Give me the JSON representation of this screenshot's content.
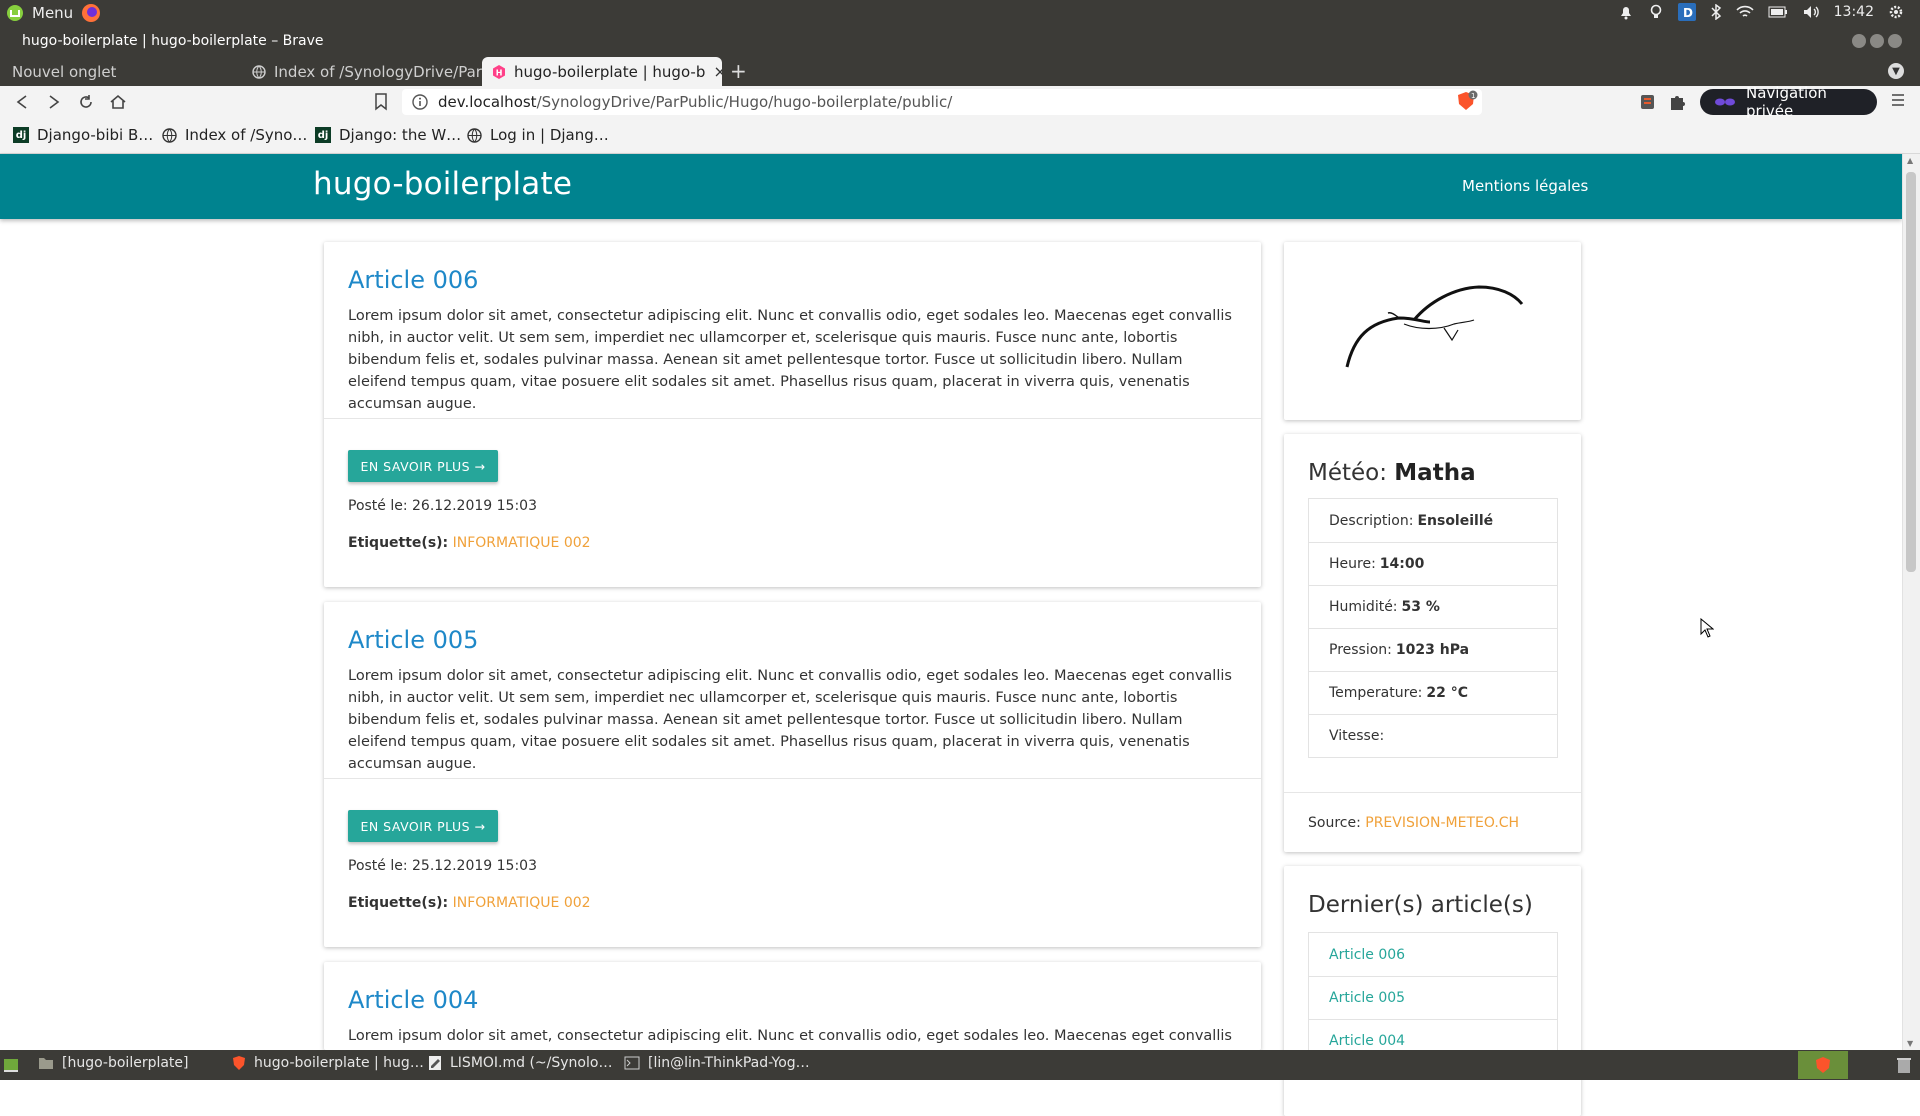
{
  "os": {
    "menu_label": "Menu",
    "clock": "13:42"
  },
  "window": {
    "title": "hugo-boilerplate | hugo-boilerplate – Brave"
  },
  "tabs": [
    {
      "label": "Nouvel onglet"
    },
    {
      "label": "Index of /SynologyDrive/ParP"
    },
    {
      "label": "hugo-boilerplate | hugo-b"
    }
  ],
  "toolbar": {
    "url_host": "dev.localhost",
    "url_path": "/SynologyDrive/ParPublic/Hugo/hugo-boilerplate/public/",
    "shield_count": "1",
    "private_label": "Navigation privée"
  },
  "bookmarks": [
    {
      "label": "Django-bibi B…",
      "icon": "django-icon"
    },
    {
      "label": "Index of /Syno…",
      "icon": "globe-icon"
    },
    {
      "label": "Django: the W…",
      "icon": "django-icon"
    },
    {
      "label": "Log in | Djang…",
      "icon": "globe-icon"
    }
  ],
  "site": {
    "title": "hugo-boilerplate",
    "nav_legal": "Mentions légales"
  },
  "articles": [
    {
      "title": "Article 006",
      "body": "Lorem ipsum dolor sit amet, consectetur adipiscing elit. Nunc et convallis odio, eget sodales leo. Maecenas eget convallis nibh, in auctor velit. Ut sem sem, imperdiet nec ullamcorper et, scelerisque quis mauris. Fusce nunc ante, lobortis bibendum felis et, sodales pulvinar massa. Aenean sit amet pellentesque tortor. Fusce ut sollicitudin libero. Nullam eleifend tempus quam, vitae posuere elit sodales sit amet. Phasellus risus quam, placerat in viverra quis, venenatis accumsan augue.",
      "button": "EN SAVOIR PLUS →",
      "posted": "Posté le: 26.12.2019 15:03",
      "tags_label": "Etiquette(s):",
      "tag": "INFORMATIQUE 002"
    },
    {
      "title": "Article 005",
      "body": "Lorem ipsum dolor sit amet, consectetur adipiscing elit. Nunc et convallis odio, eget sodales leo. Maecenas eget convallis nibh, in auctor velit. Ut sem sem, imperdiet nec ullamcorper et, scelerisque quis mauris. Fusce nunc ante, lobortis bibendum felis et, sodales pulvinar massa. Aenean sit amet pellentesque tortor. Fusce ut sollicitudin libero. Nullam eleifend tempus quam, vitae posuere elit sodales sit amet. Phasellus risus quam, placerat in viverra quis, venenatis accumsan augue.",
      "button": "EN SAVOIR PLUS →",
      "posted": "Posté le: 25.12.2019 15:03",
      "tags_label": "Etiquette(s):",
      "tag": "INFORMATIQUE 002"
    },
    {
      "title": "Article 004",
      "body": "Lorem ipsum dolor sit amet, consectetur adipiscing elit. Nunc et convallis odio, eget sodales leo. Maecenas eget convallis nibh, in"
    }
  ],
  "weather": {
    "title_prefix": "Météo:",
    "location": "Matha",
    "rows": [
      {
        "label": "Description:",
        "value": "Ensoleillé"
      },
      {
        "label": "Heure:",
        "value": "14:00"
      },
      {
        "label": "Humidité:",
        "value": "53 %"
      },
      {
        "label": "Pression:",
        "value": "1023 hPa"
      },
      {
        "label": "Temperature:",
        "value": "22 °C"
      },
      {
        "label": "Vitesse:",
        "value": ""
      }
    ],
    "source_label": "Source:",
    "source_link": "PREVISION-METEO.CH"
  },
  "latest": {
    "title": "Dernier(s) article(s)",
    "items": [
      "Article 006",
      "Article 005",
      "Article 004"
    ]
  },
  "taskbar": [
    {
      "label": "[hugo-boilerplate]",
      "icon": "folder-icon"
    },
    {
      "label": "hugo-boilerplate | hug…",
      "icon": "brave-icon"
    },
    {
      "label": "LISMOI.md (~/Synolo…",
      "icon": "editor-icon"
    },
    {
      "label": "[lin@lin-ThinkPad-Yog…",
      "icon": "terminal-icon"
    }
  ],
  "colors": {
    "header": "#00838f",
    "link_blue": "#1e88c8",
    "button_teal": "#26a69a",
    "tag_orange": "#f0a13a"
  }
}
